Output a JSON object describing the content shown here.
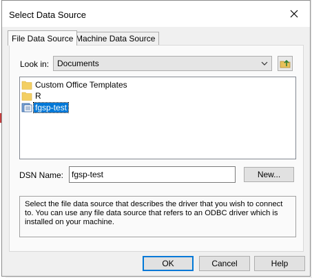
{
  "dialog": {
    "title": "Select Data Source",
    "close_icon": "close-icon"
  },
  "tabs": [
    {
      "label": "File Data Source",
      "active": true
    },
    {
      "label": "Machine Data Source",
      "active": false
    }
  ],
  "look_in": {
    "label": "Look in:",
    "value": "Documents",
    "up_folder_icon": "folder-up-icon"
  },
  "files": [
    {
      "name": "Custom Office Templates",
      "icon": "folder-icon",
      "selected": false
    },
    {
      "name": "R",
      "icon": "folder-icon",
      "selected": false
    },
    {
      "name": "fgsp-test",
      "icon": "dsn-file-icon",
      "selected": true
    }
  ],
  "dsn": {
    "label": "DSN Name:",
    "value": "fgsp-test",
    "new_button": "New..."
  },
  "description": "Select the file data source that describes the driver that you wish to connect to. You can use any file data source that refers to an ODBC driver which is installed on your machine.",
  "buttons": {
    "ok": "OK",
    "cancel": "Cancel",
    "help": "Help"
  },
  "colors": {
    "accent": "#0078d7",
    "background": "#f0f0f0"
  }
}
